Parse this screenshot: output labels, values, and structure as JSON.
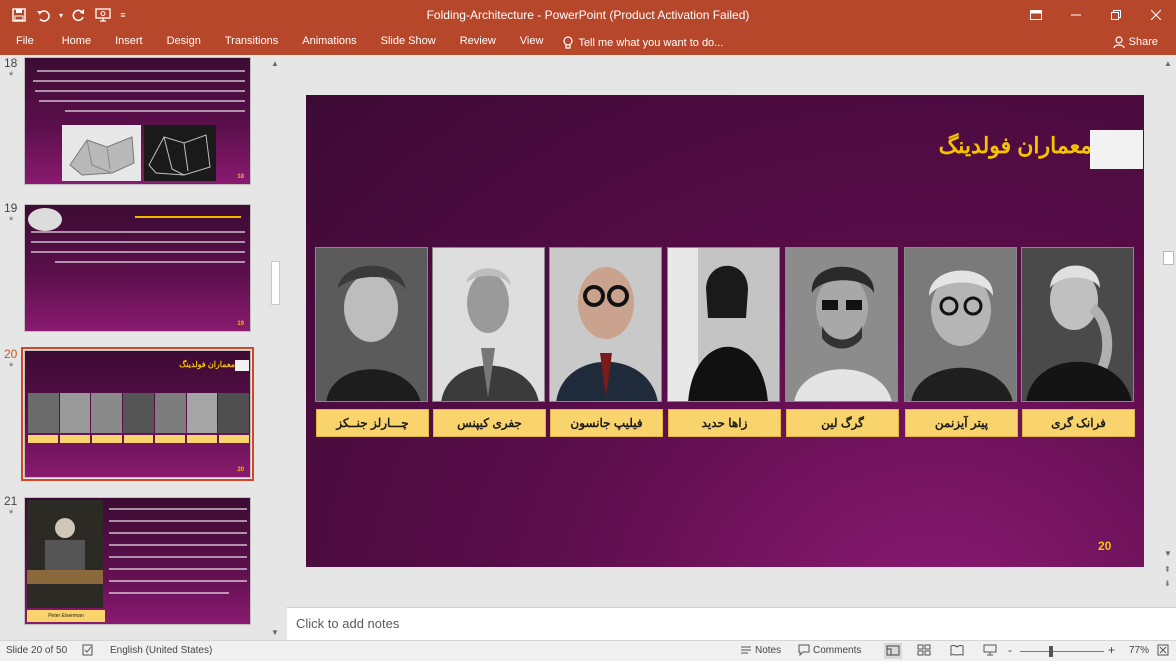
{
  "window": {
    "title": "Folding-Architecture - PowerPoint (Product Activation Failed)"
  },
  "qat": {
    "save_icon": "save-icon",
    "undo_icon": "undo-icon",
    "redo_icon": "redo-icon",
    "present_icon": "start-from-beginning-icon",
    "customize_icon": "customize-qat-icon"
  },
  "ribbon": {
    "tabs": [
      "File",
      "Home",
      "Insert",
      "Design",
      "Transitions",
      "Animations",
      "Slide Show",
      "Review",
      "View"
    ],
    "tellme": "Tell me what you want to do...",
    "share": "Share"
  },
  "thumbnails": [
    {
      "number": "18",
      "star": "*"
    },
    {
      "number": "19",
      "star": "*"
    },
    {
      "number": "20",
      "star": "*"
    },
    {
      "number": "21",
      "star": "*"
    }
  ],
  "slide": {
    "title": "معماران فولدینگ",
    "number": "20",
    "names": [
      "فرانک گری",
      "پیتر آیزنمن",
      "گرگ لین",
      "زاها حدید",
      "فیلیپ جانسون",
      "جفری کیپنس",
      "چـــارلز جنــکز"
    ]
  },
  "thumb_texts": {
    "slide20_title": "معماران فولدینگ",
    "slide21_caption": "Peter Eisenman"
  },
  "notes": {
    "placeholder": "Click to add notes"
  },
  "status": {
    "slide_info": "Slide 20 of 50",
    "language": "English (United States)",
    "notes": "Notes",
    "comments": "Comments",
    "zoom_minus": "-",
    "zoom_plus": "+",
    "zoom": "77%"
  }
}
